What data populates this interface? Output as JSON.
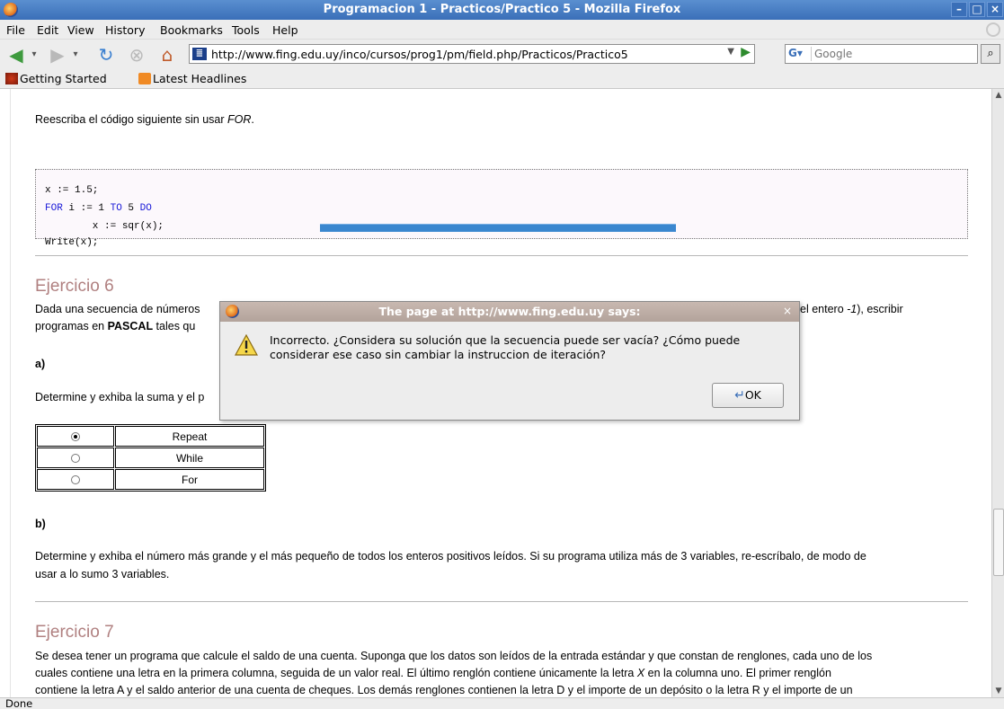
{
  "window": {
    "title": "Programacion 1 - Practicos/Practico 5 - Mozilla Firefox",
    "minimize": "–",
    "maximize": "□",
    "close": "×"
  },
  "menu": [
    "File",
    "Edit",
    "View",
    "History",
    "Bookmarks",
    "Tools",
    "Help"
  ],
  "nav": {
    "url": "http://www.fing.edu.uy/inco/cursos/prog1/pm/field.php/Practicos/Practico5",
    "search_placeholder": "Google",
    "search_engine": "G"
  },
  "bookmarks": [
    "Getting Started",
    "Latest Headlines"
  ],
  "page": {
    "intro": "Reescriba el código siguiente sin usar FOR.",
    "intro_plain": "Reescriba el código siguiente sin usar ",
    "intro_em": "FOR",
    "code": {
      "line1": "x := 1.5;",
      "line2_kw1": "FOR",
      "line2_mid": " i := 1 ",
      "line2_kw2": "TO",
      "line2_mid2": " 5 ",
      "line2_kw3": "DO",
      "line3": "        x := sqr(x);",
      "line4": "Write(x);"
    },
    "ej6_title": "Ejercicio 6",
    "ej6_text_left": "Dada una secuencia de números",
    "ej6_text_right_a": "el entero ",
    "ej6_text_right_em": "-1",
    "ej6_text_right_b": "), escribir",
    "ej6_line2_a": "programas en ",
    "ej6_line2_b": "PASCAL",
    "ej6_line2_c": " tales qu",
    "a_label": "a)",
    "a_text": "Determine y exhiba la suma y el p",
    "options": [
      {
        "label": "Repeat",
        "selected": true
      },
      {
        "label": "While",
        "selected": false
      },
      {
        "label": "For",
        "selected": false
      }
    ],
    "b_label": "b)",
    "b_text1": "Determine y exhiba el número más grande y el más pequeño de todos los enteros positivos leídos. Si su programa utiliza más de 3 variables, re-escríbalo, de modo de",
    "b_text2": "usar a lo sumo 3 variables.",
    "ej7_title": "Ejercicio 7",
    "ej7_line1": "Se desea tener un programa que calcule el saldo de una cuenta. Suponga que los datos son leídos de la entrada estándar y que constan de renglones, cada uno de los",
    "ej7_line2_a": "cuales contiene una letra en la primera columna, seguida de un valor real. El último renglón contiene únicamente la letra ",
    "ej7_line2_em": "X",
    "ej7_line2_b": " en la columna uno. El primer renglón",
    "ej7_line3": "contiene la letra A y el saldo anterior de una cuenta de cheques. Los demás renglones contienen la letra D y el importe de un depósito o la letra R y el importe de un"
  },
  "dialog": {
    "title": "The page at http://www.fing.edu.uy says:",
    "message": "Incorrecto.  ¿Considera su solución que la secuencia puede ser vacía? ¿Cómo puede considerar ese caso sin cambiar la instruccion de iteración?",
    "ok_label": "OK",
    "close": "×"
  },
  "status": "Done",
  "colors": {
    "heading": "#b08080",
    "keyword": "#1a1ad8",
    "titlebar": "#3a6fb8"
  }
}
